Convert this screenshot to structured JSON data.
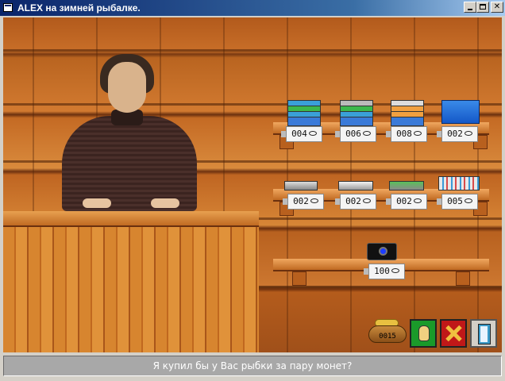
{
  "window": {
    "title": "ALEX на зимней рыбалке.",
    "controls": {
      "minimize": "_",
      "maximize": "□",
      "close": "✕"
    }
  },
  "shop": {
    "top_shelf": [
      {
        "name": "green-blue-stack-1",
        "price": "004"
      },
      {
        "name": "green-blue-stack-2",
        "price": "006"
      },
      {
        "name": "orange-blue-stack",
        "price": "008"
      },
      {
        "name": "blue-box",
        "price": "002"
      }
    ],
    "middle_shelf": [
      {
        "name": "gray-tin",
        "price": "002"
      },
      {
        "name": "white-tin",
        "price": "002"
      },
      {
        "name": "green-tin",
        "price": "002"
      },
      {
        "name": "lure-box",
        "price": "005"
      }
    ],
    "bottom_shelf": [
      {
        "name": "camera",
        "price": "100"
      }
    ]
  },
  "toolbar": {
    "money": "0015",
    "icons": [
      "money-bag-icon",
      "hand-icon",
      "cancel-icon",
      "exit-door-icon"
    ]
  },
  "status_text": "Я купил бы у Вас рыбки за пару монет?",
  "colors": {
    "titlebar": "#0a246a",
    "wood": "#c86e28",
    "status": "#a8a8a8"
  }
}
